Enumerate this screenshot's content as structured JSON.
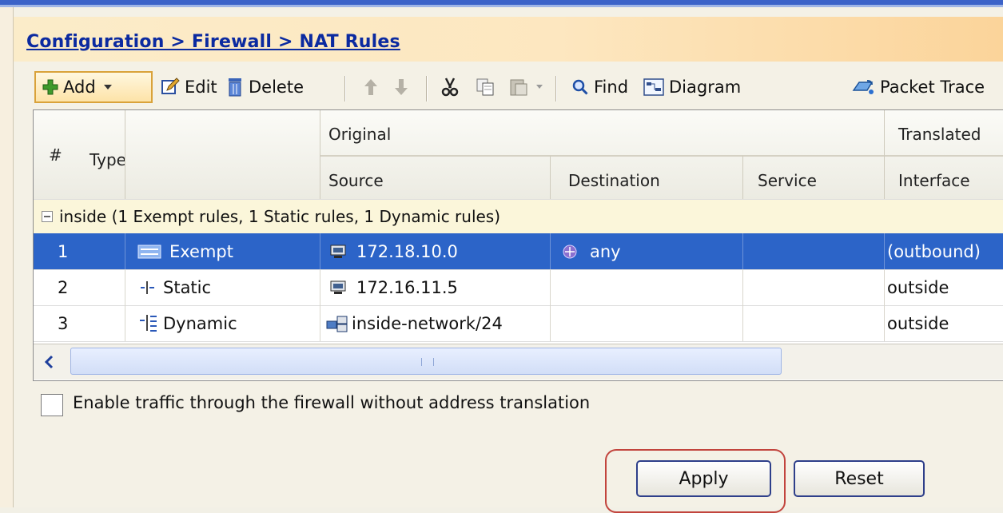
{
  "breadcrumb": "Configuration > Firewall > NAT Rules",
  "toolbar": {
    "add": "Add",
    "edit": "Edit",
    "delete": "Delete",
    "find": "Find",
    "diagram": "Diagram",
    "packet_trace": "Packet Trace"
  },
  "table": {
    "col_num": "#",
    "col_type": "Type",
    "group_original": "Original",
    "group_translated": "Translated",
    "col_source": "Source",
    "col_destination": "Destination",
    "col_service": "Service",
    "col_interface": "Interface",
    "group_row": "inside (1 Exempt rules, 1 Static rules, 1 Dynamic rules)",
    "rows": [
      {
        "num": "1",
        "type": "Exempt",
        "source": "172.18.10.0",
        "destination": "any",
        "service": "",
        "interface": "(outbound)"
      },
      {
        "num": "2",
        "type": "Static",
        "source": "172.16.11.5",
        "destination": "",
        "service": "",
        "interface": "outside"
      },
      {
        "num": "3",
        "type": "Dynamic",
        "source": "inside-network/24",
        "destination": "",
        "service": "",
        "interface": "outside"
      }
    ]
  },
  "options": {
    "enable_traffic_label": "Enable traffic through the firewall without address translation",
    "enable_traffic_checked": false
  },
  "buttons": {
    "apply": "Apply",
    "reset": "Reset"
  },
  "colors": {
    "selection": "#2c64c8",
    "breadcrumb": "#0b2aa0",
    "highlight_ring": "#c2443d"
  }
}
